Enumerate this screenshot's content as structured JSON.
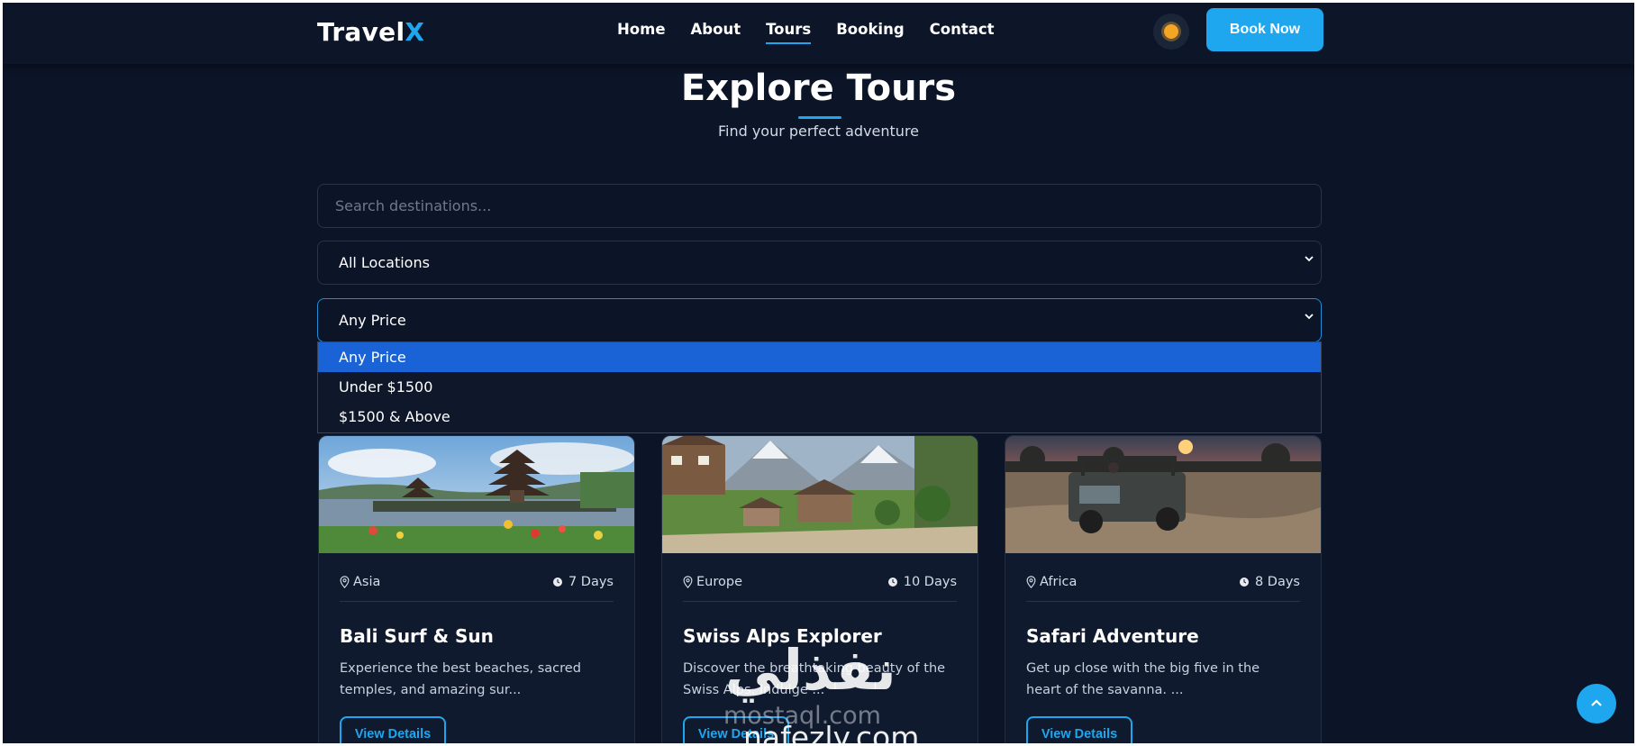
{
  "nav": {
    "logo_main": "Travel",
    "logo_accent": "X",
    "links": [
      "Home",
      "About",
      "Tours",
      "Booking",
      "Contact"
    ],
    "active_link": "Tours",
    "theme_icon": "sun-icon",
    "cta": "Book Now"
  },
  "header": {
    "title": "Explore Tours",
    "subtitle": "Find your perfect adventure"
  },
  "filters": {
    "search_placeholder": "Search destinations...",
    "location_selected": "All Locations",
    "price_selected": "Any Price",
    "price_options": [
      "Any Price",
      "Under $1500",
      "$1500 & Above"
    ]
  },
  "tours": [
    {
      "location": "Asia",
      "duration": "7 Days",
      "title": "Bali Surf & Sun",
      "description": "Experience the best beaches, sacred temples, and amazing sur...",
      "button": "View Details"
    },
    {
      "location": "Europe",
      "duration": "10 Days",
      "title": "Swiss Alps Explorer",
      "description": "Discover the breathtaking beauty of the Swiss Alps. Indulge ...",
      "button": "View Details"
    },
    {
      "location": "Africa",
      "duration": "8 Days",
      "title": "Safari Adventure",
      "description": "Get up close with the big five in the heart of the savanna. ...",
      "button": "View Details"
    }
  ],
  "watermark": {
    "arabic": "نفذلي",
    "line1": "mostaql.com",
    "line2": "nafezly.com"
  },
  "colors": {
    "background": "#0c1427",
    "accent": "#1ea7ef",
    "selected_option": "#1a63d6"
  }
}
